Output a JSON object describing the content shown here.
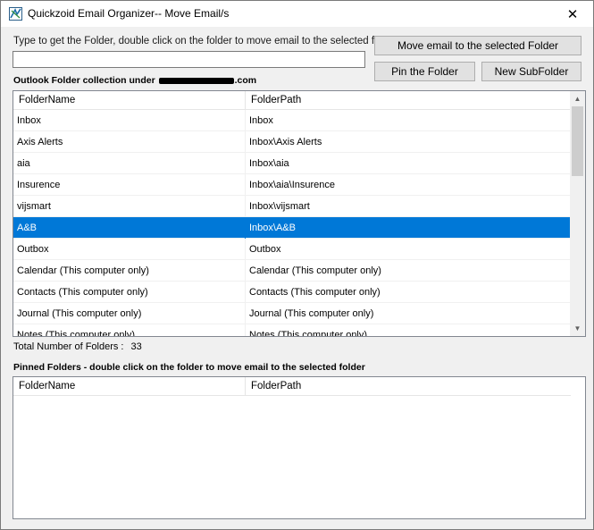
{
  "window": {
    "title": "Quickzoid Email Organizer-- Move Email/s",
    "close_glyph": "✕"
  },
  "search": {
    "instruction": "Type to get the Folder, double click on the folder to move email to the selected folder",
    "value": "",
    "placeholder": ""
  },
  "buttons": {
    "move": "Move email to the selected Folder",
    "pin": "Pin the Folder",
    "new_subfolder": "New SubFolder"
  },
  "outlook": {
    "label_prefix": "Outlook Folder collection under ",
    "label_suffix": ".com",
    "columns": {
      "name": "FolderName",
      "path": "FolderPath"
    },
    "rows": [
      {
        "name": "Inbox",
        "path": "Inbox"
      },
      {
        "name": "Axis Alerts",
        "path": "Inbox\\Axis Alerts"
      },
      {
        "name": "aia",
        "path": "Inbox\\aia"
      },
      {
        "name": "Insurence",
        "path": "Inbox\\aia\\Insurence"
      },
      {
        "name": "vijsmart",
        "path": "Inbox\\vijsmart"
      },
      {
        "name": "A&B",
        "path": "Inbox\\A&B"
      },
      {
        "name": "Outbox",
        "path": "Outbox"
      },
      {
        "name": "Calendar (This computer only)",
        "path": "Calendar (This computer only)"
      },
      {
        "name": "Contacts (This computer only)",
        "path": "Contacts (This computer only)"
      },
      {
        "name": "Journal (This computer only)",
        "path": "Journal (This computer only)"
      },
      {
        "name": "Notes (This computer only)",
        "path": "Notes (This computer only)"
      }
    ],
    "selected_index": 5,
    "total_label": "Total Number of Folders :",
    "total_count": "33"
  },
  "pinned": {
    "label": "Pinned Folders - double click on the folder to move email to the selected folder",
    "columns": {
      "name": "FolderName",
      "path": "FolderPath"
    },
    "rows": []
  },
  "colors": {
    "selection": "#0078d7",
    "window_bg": "#f0f0f0"
  },
  "icons": {
    "app": "quickzoid-app-icon",
    "close": "close-icon",
    "scroll_up": "scroll-up-arrow-icon",
    "scroll_down": "scroll-down-arrow-icon"
  }
}
